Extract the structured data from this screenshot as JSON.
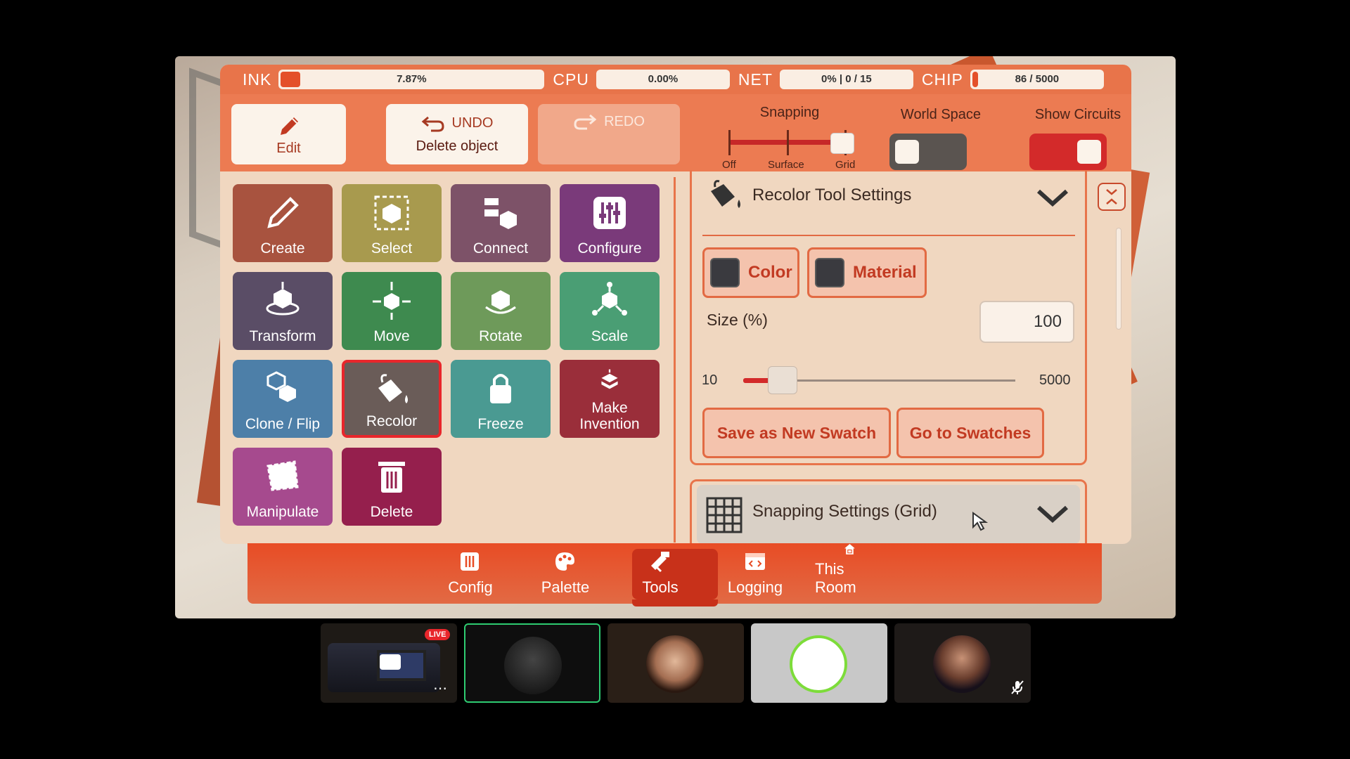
{
  "stats": {
    "ink_label": "INK",
    "ink_value": "7.87%",
    "ink_fraction": 0.0787,
    "cpu_label": "CPU",
    "cpu_value": "0.00%",
    "net_label": "NET",
    "net_value": "0% | 0 / 15",
    "chip_label": "CHIP",
    "chip_value": "86 / 5000",
    "chip_fraction": 0.0172
  },
  "toolbar": {
    "edit_label": "Edit",
    "undo_label": "UNDO",
    "undo_action": "Delete object",
    "redo_label": "REDO",
    "snapping_label": "Snapping",
    "snapping_options": [
      "Off",
      "Surface",
      "Grid"
    ],
    "snapping_selected": "Grid",
    "world_space_label": "World Space",
    "world_space_on": false,
    "show_circuits_label": "Show Circuits",
    "show_circuits_on": true
  },
  "tools": [
    {
      "label": "Create",
      "icon": "pencil-icon",
      "color": "#a8533f"
    },
    {
      "label": "Select",
      "icon": "select-cube-icon",
      "color": "#a89a4e"
    },
    {
      "label": "Connect",
      "icon": "connect-icon",
      "color": "#7d5268"
    },
    {
      "label": "Configure",
      "icon": "sliders-icon",
      "color": "#7a3a7a"
    },
    {
      "label": "Transform",
      "icon": "transform-cube-icon",
      "color": "#5a4d66"
    },
    {
      "label": "Move",
      "icon": "move-cube-icon",
      "color": "#3e8a4f"
    },
    {
      "label": "Rotate",
      "icon": "rotate-cube-icon",
      "color": "#6e9a5a"
    },
    {
      "label": "Scale",
      "icon": "scale-cube-icon",
      "color": "#4a9e74"
    },
    {
      "label": "Clone / Flip",
      "icon": "clone-icon",
      "color": "#4d7fa8"
    },
    {
      "label": "Recolor",
      "icon": "paint-bucket-icon",
      "color": "#6a5c58"
    },
    {
      "label": "Freeze",
      "icon": "lock-icon",
      "color": "#4a9a92"
    },
    {
      "label": "Make Invention",
      "icon": "invention-icon",
      "color": "#9a2e3a"
    },
    {
      "label": "Manipulate",
      "icon": "manipulate-icon",
      "color": "#a64a8e"
    },
    {
      "label": "Delete",
      "icon": "trash-icon",
      "color": "#951f4d"
    }
  ],
  "selected_tool": "Recolor",
  "recolor": {
    "title": "Recolor Tool Settings",
    "color_label": "Color",
    "material_label": "Material",
    "size_label": "Size (%)",
    "size_value": "100",
    "slider_min": "10",
    "slider_max": "5000",
    "slider_value": 100,
    "save_swatch_label": "Save as New Swatch",
    "go_swatches_label": "Go to Swatches"
  },
  "snapping_section": {
    "title": "Snapping Settings (Grid)"
  },
  "nav": [
    {
      "label": "Config",
      "icon": "sliders-icon"
    },
    {
      "label": "Palette",
      "icon": "palette-icon"
    },
    {
      "label": "Tools",
      "icon": "tools-icon",
      "active": true
    },
    {
      "label": "Logging",
      "icon": "code-window-icon"
    },
    {
      "label": "This Room",
      "icon": "room-icon"
    }
  ],
  "participants": {
    "live_badge": "LIVE"
  }
}
